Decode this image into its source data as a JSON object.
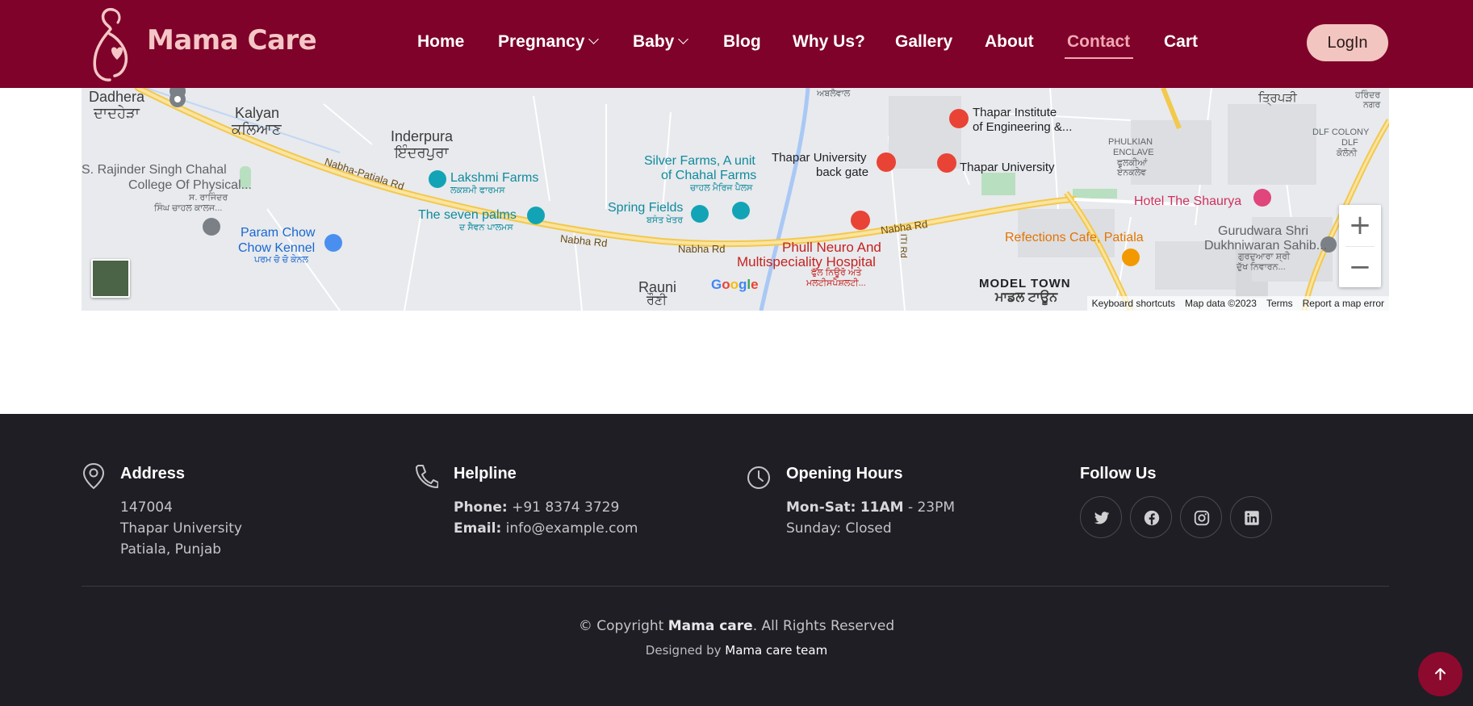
{
  "brand": {
    "name": "Mama Care"
  },
  "nav": {
    "items": [
      {
        "label": "Home"
      },
      {
        "label": "Pregnancy"
      },
      {
        "label": "Baby"
      },
      {
        "label": "Blog"
      },
      {
        "label": "Why Us?"
      },
      {
        "label": "Gallery"
      },
      {
        "label": "About"
      },
      {
        "label": "Contact"
      },
      {
        "label": "Cart"
      }
    ],
    "active": "Contact",
    "login_label": "LogIn"
  },
  "map": {
    "places": [
      {
        "text": "Dadhera"
      },
      {
        "text": "ਦਾਦਹੇੜਾ"
      },
      {
        "text": "Kalyan"
      },
      {
        "text": "ਕਲਿਆਣ"
      },
      {
        "text": "Inderpura"
      },
      {
        "text": "ਇੰਦਰਪੁਰਾ"
      },
      {
        "text": "S. Rajinder Singh Chahal"
      },
      {
        "text": "College Of Physical..."
      },
      {
        "text": "ਸ. ਰਾਜਿੰਦਰ"
      },
      {
        "text": "ਸਿੰਘ ਚਾਹਲ ਕਾਲਜ..."
      },
      {
        "text": "Param Chow"
      },
      {
        "text": "Chow Kennel"
      },
      {
        "text": "ਪਰਮ ਚੋ ਚੋ ਕੇਨਲ"
      },
      {
        "text": "Lakshmi Farms"
      },
      {
        "text": "ਲਕਸ਼ਮੀ ਫਾਰਮਸ"
      },
      {
        "text": "The seven palms"
      },
      {
        "text": "ਦ ਸੈਵਨ ਪਾਲਮਸ"
      },
      {
        "text": "Silver Farms, A unit"
      },
      {
        "text": "of Chahal Farms"
      },
      {
        "text": "ਚਾਹਲ ਮੈਰਿਜ ਪੈਲਸ"
      },
      {
        "text": "Spring Fields"
      },
      {
        "text": "ਬਸੰਤ ਖੇਤਰ"
      },
      {
        "text": "Thapar University"
      },
      {
        "text": "back gate"
      },
      {
        "text": "Thapar Institute"
      },
      {
        "text": "of Engineering &..."
      },
      {
        "text": "Thapar University"
      },
      {
        "text": "PHULKIAN"
      },
      {
        "text": "ENCLAVE"
      },
      {
        "text": "ਫੁਲਕੀਆਂ"
      },
      {
        "text": "ਏਨਕਲੇਵ"
      },
      {
        "text": "DLF COLONY"
      },
      {
        "text": "DLF"
      },
      {
        "text": "ਕੋਲੋਨੀ"
      },
      {
        "text": "ਤ੍ਰਿਪੜੀ"
      },
      {
        "text": "ਹਰਿੰਦਰ"
      },
      {
        "text": "ਨਗਰ"
      },
      {
        "text": "ਅਬਲੋਵਾਲ"
      },
      {
        "text": "Hotel The Shaurya"
      },
      {
        "text": "Gurudwara Shri"
      },
      {
        "text": "Dukhniwaran Sahib..."
      },
      {
        "text": "ਗੁਰਦੁਆਰਾ ਸ਼੍ਰੀ"
      },
      {
        "text": "ਦੁੱਖ ਨਿਵਾਰਨ..."
      },
      {
        "text": "Refections Cafe, Patiala"
      },
      {
        "text": "Phull Neuro And"
      },
      {
        "text": "Multispeciality Hospital"
      },
      {
        "text": "ਫੁੱਲ ਨਿਊਰੋ ਅਤੇ"
      },
      {
        "text": "ਮਲਟੀਸਪੈਸ਼ਲਟੀ..."
      },
      {
        "text": "MODEL TOWN"
      },
      {
        "text": "ਮਾਡਲ ਟਾਊਨ"
      },
      {
        "text": "Rauni"
      },
      {
        "text": "ਰੌਣੀ"
      }
    ],
    "roads": [
      {
        "text": "Nabha-Patiala Rd"
      },
      {
        "text": "Nabha Rd"
      },
      {
        "text": "Nabha Rd"
      },
      {
        "text": "Nabha Rd"
      },
      {
        "text": "ITI Rd"
      }
    ],
    "google": "Google",
    "attribution": {
      "shortcuts": "Keyboard shortcuts",
      "data": "Map data ©2023",
      "terms": "Terms",
      "report": "Report a map error"
    },
    "zoom_in": "+",
    "zoom_out": "−"
  },
  "footer": {
    "address": {
      "title": "Address",
      "lines": [
        "147004",
        "Thapar University",
        "Patiala, Punjab"
      ]
    },
    "helpline": {
      "title": "Helpline",
      "phone_label": "Phone:",
      "phone": "+91 8374 3729",
      "email_label": "Email:",
      "email": "info@example.com"
    },
    "hours": {
      "title": "Opening Hours",
      "weekday_label": "Mon-Sat:",
      "weekday_open": "11AM",
      "weekday_close": "- 23PM",
      "sunday": "Sunday: Closed"
    },
    "follow": {
      "title": "Follow Us",
      "icons": [
        "twitter-icon",
        "facebook-icon",
        "instagram-icon",
        "linkedin-icon"
      ]
    },
    "copyright": {
      "prefix": "© Copyright",
      "name": "Mama care",
      "suffix": ". All Rights Reserved"
    },
    "designed": {
      "prefix": "Designed by",
      "name": "Mama care team"
    }
  },
  "colors": {
    "header_bg": "#7e0229",
    "brand_text": "#f5c6c6",
    "active_nav": "#f2a7b4",
    "login_bg": "#f3c5c0",
    "footer_bg": "#1f1e24",
    "back_to_top": "#8c0a2e"
  }
}
